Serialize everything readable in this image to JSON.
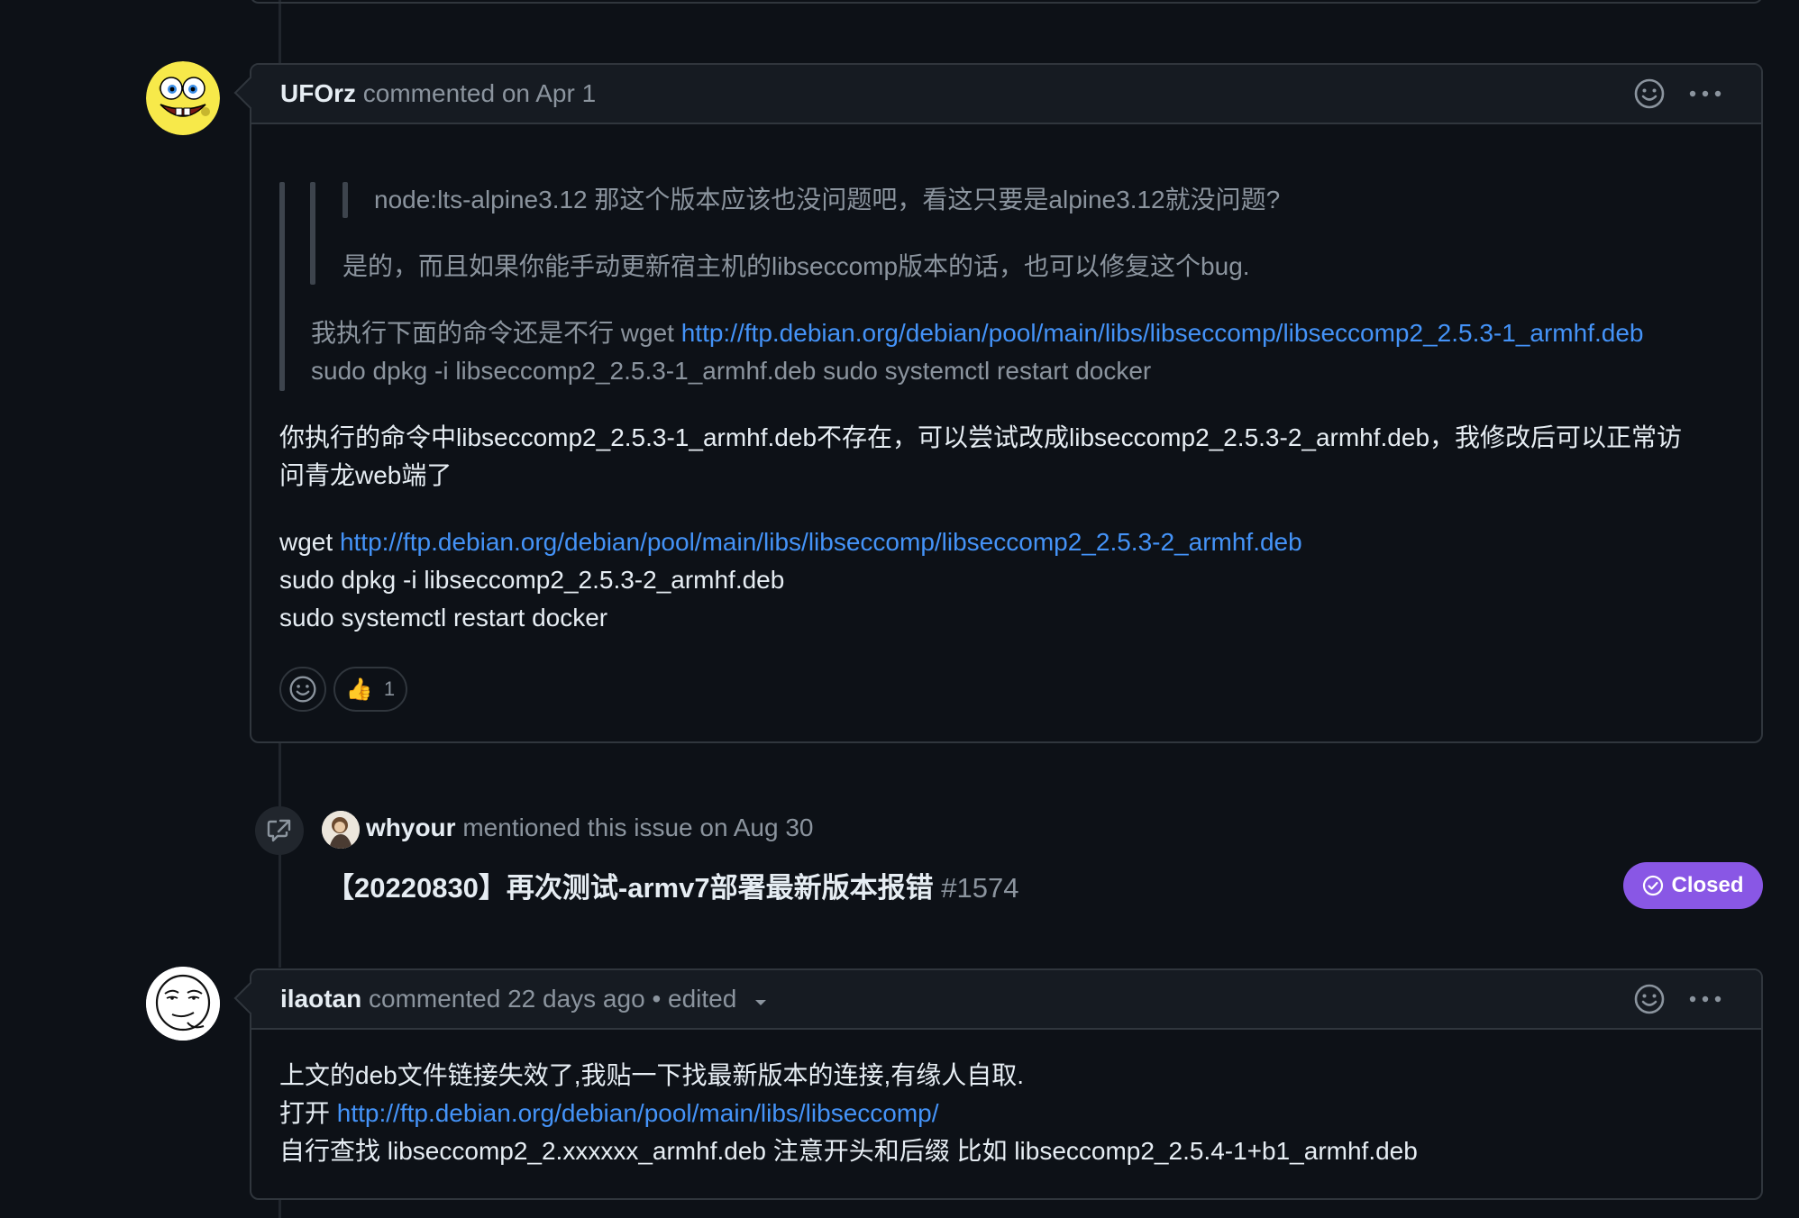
{
  "comments": [
    {
      "author": "UFOrz",
      "meta": "commented on Apr 1",
      "quote_inner": "node:lts-alpine3.12 那这个版本应该也没问题吧，看这只要是alpine3.12就没问题?",
      "quote_mid": "是的，而且如果你能手动更新宿主机的libseccomp版本的话，也可以修复这个bug.",
      "quote_outer_prefix": "我执行下面的命令还是不行 wget ",
      "quote_outer_link": "http://ftp.debian.org/debian/pool/main/libs/libseccomp/libseccomp2_2.5.3-1_armhf.deb",
      "quote_outer_line2": "sudo dpkg -i libseccomp2_2.5.3-1_armhf.deb sudo systemctl restart docker",
      "reply_line1": "你执行的命令中libseccomp2_2.5.3-1_armhf.deb不存在，可以尝试改成libseccomp2_2.5.3-2_armhf.deb，我修改后可以正常访",
      "reply_line2": "问青龙web端了",
      "cmd_prefix": "wget ",
      "cmd_link": "http://ftp.debian.org/debian/pool/main/libs/libseccomp/libseccomp2_2.5.3-2_armhf.deb",
      "cmd_line2": "sudo dpkg -i libseccomp2_2.5.3-2_armhf.deb",
      "cmd_line3": "sudo systemctl restart docker",
      "reaction_emoji": "👍",
      "reaction_count": "1"
    },
    {
      "author": "ilaotan",
      "meta": "commented 22 days ago",
      "edited": "• edited",
      "line1": "上文的deb文件链接失效了,我贴一下找最新版本的连接,有缘人自取.",
      "line2_prefix": "打开 ",
      "line2_link": "http://ftp.debian.org/debian/pool/main/libs/libseccomp/",
      "line3": "自行查找 libseccomp2_2.xxxxxx_armhf.deb 注意开头和后缀 比如 libseccomp2_2.5.4-1+b1_armhf.deb"
    }
  ],
  "mention": {
    "author": "whyour",
    "meta": "mentioned this issue on Aug 30",
    "issue_title": "【20220830】再次测试-armv7部署最新版本报错",
    "issue_number": "#1574",
    "status": "Closed"
  },
  "colors": {
    "background": "#0d1117",
    "link": "#4493f8",
    "closed_badge": "#8957e5",
    "border": "#30363d"
  }
}
